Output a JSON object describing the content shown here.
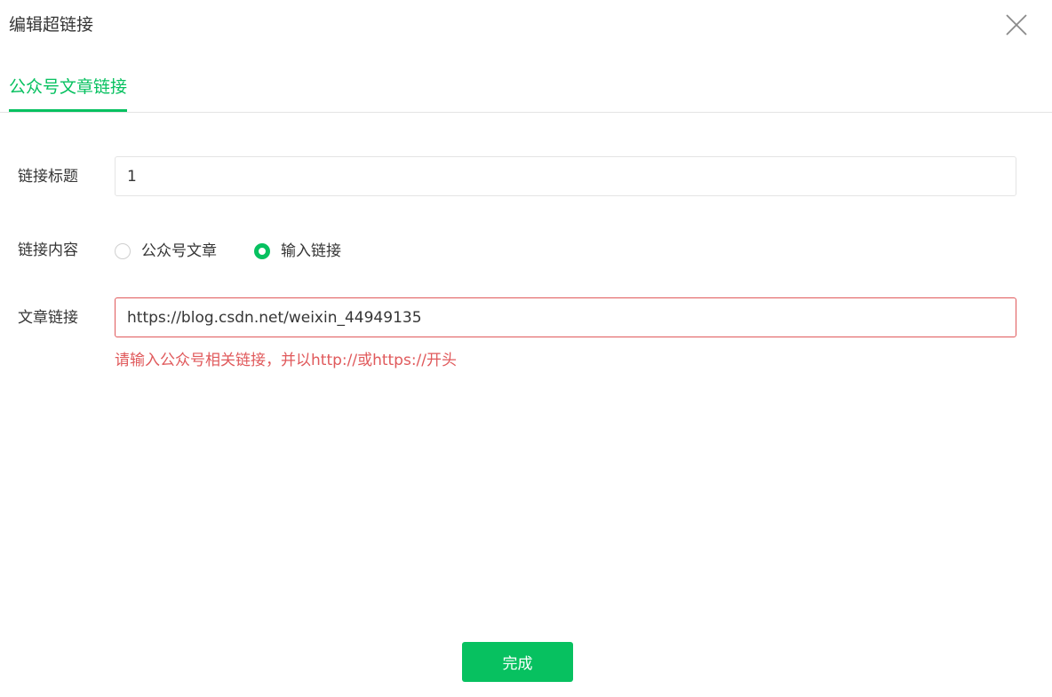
{
  "dialog": {
    "title": "编辑超链接",
    "close_icon": "close-icon"
  },
  "tabs": [
    {
      "label": "公众号文章链接",
      "active": true
    }
  ],
  "form": {
    "link_title": {
      "label": "链接标题",
      "value": "1"
    },
    "link_content": {
      "label": "链接内容",
      "options": [
        {
          "label": "公众号文章",
          "checked": false
        },
        {
          "label": "输入链接",
          "checked": true
        }
      ]
    },
    "article_link": {
      "label": "文章链接",
      "value": "https://blog.csdn.net/weixin_44949135",
      "error": "请输入公众号相关链接，并以http://或https://开头"
    }
  },
  "footer": {
    "done_label": "完成"
  },
  "colors": {
    "accent": "#07c160",
    "error": "#e0595b",
    "text": "#353535"
  }
}
